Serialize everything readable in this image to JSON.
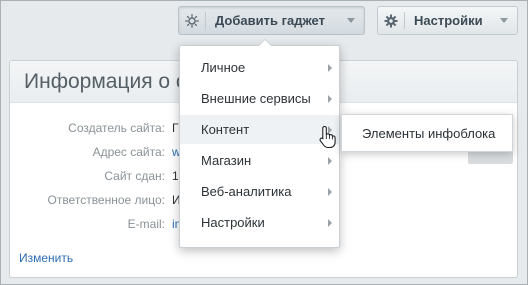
{
  "toolbar": {
    "add_gadget_label": "Добавить гаджет",
    "settings_label": "Настройки"
  },
  "panel": {
    "title": "Информация о с",
    "rows": [
      {
        "key": "Создатель сайта:",
        "value": "Г"
      },
      {
        "key": "Адрес сайта:",
        "value": "w"
      },
      {
        "key": "Сайт сдан:",
        "value": "1"
      },
      {
        "key": "Ответственное лицо:",
        "value": "И"
      },
      {
        "key": "E-mail:",
        "value": "in"
      }
    ],
    "change_link": "Изменить"
  },
  "menu": {
    "items": [
      {
        "label": "Личное",
        "has_submenu": true
      },
      {
        "label": "Внешние сервисы",
        "has_submenu": true
      },
      {
        "label": "Контент",
        "has_submenu": true,
        "active": true
      },
      {
        "label": "Магазин",
        "has_submenu": true
      },
      {
        "label": "Веб-аналитика",
        "has_submenu": true
      },
      {
        "label": "Настройки",
        "has_submenu": true
      }
    ],
    "submenu_item": "Элементы инфоблока"
  },
  "colors": {
    "link": "#2d6db4",
    "menu_active_bg": "#eef2f4",
    "panel_bg": "#ffffff",
    "page_bg": "#e6eaed"
  },
  "icons": {
    "gadget": "sun-icon",
    "settings": "gear-icon",
    "cursor": "hand-pointer-icon"
  }
}
